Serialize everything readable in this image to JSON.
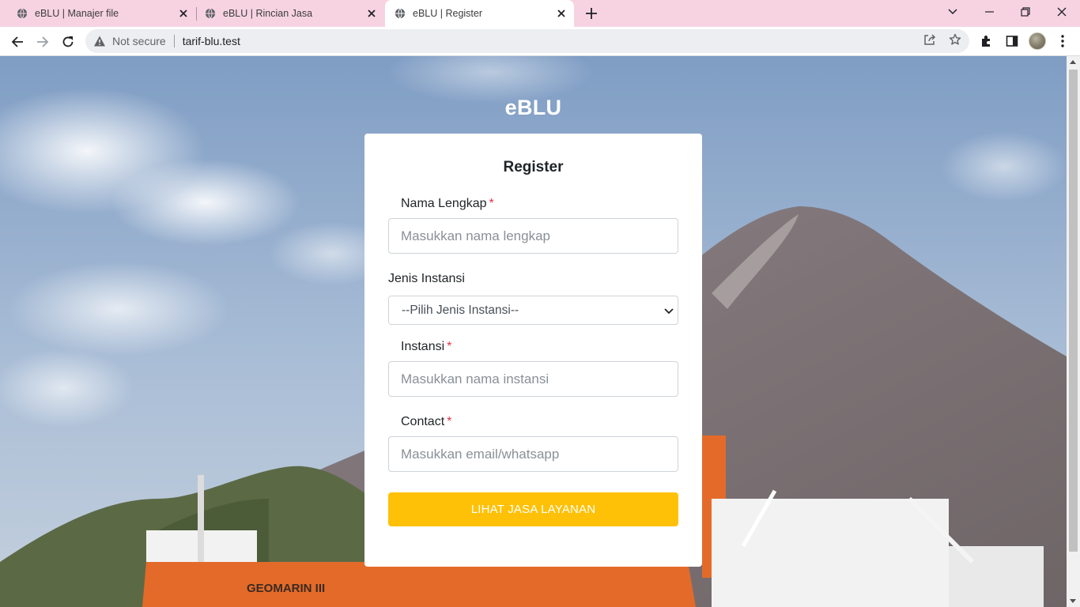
{
  "browser": {
    "tabs": [
      {
        "title": "eBLU | Manajer file",
        "active": false
      },
      {
        "title": "eBLU | Rincian Jasa",
        "active": false
      },
      {
        "title": "eBLU | Register",
        "active": true
      }
    ],
    "security_label": "Not secure",
    "url": "tarif-blu.test"
  },
  "page": {
    "brand": "eBLU",
    "ship_name": "GEOMARIN III"
  },
  "register": {
    "title": "Register",
    "fields": {
      "nama": {
        "label": "Nama Lengkap",
        "required_mark": "*",
        "placeholder": "Masukkan nama lengkap",
        "value": ""
      },
      "jenis": {
        "label": "Jenis Instansi",
        "selected": "--Pilih Jenis Instansi--"
      },
      "instansi": {
        "label": "Instansi",
        "required_mark": "*",
        "placeholder": "Masukkan nama instansi",
        "value": ""
      },
      "contact": {
        "label": "Contact",
        "required_mark": "*",
        "placeholder": "Masukkan email/whatsapp",
        "value": ""
      }
    },
    "submit_label": "LIHAT JASA LAYANAN"
  },
  "colors": {
    "tabstrip": "#f7d3e2",
    "primary_button": "#ffc107",
    "required": "#dc3545"
  },
  "icons": [
    "globe-icon",
    "close-icon",
    "plus-icon",
    "chevron-down-icon",
    "minimize-icon",
    "restore-icon",
    "back-icon",
    "forward-icon",
    "reload-icon",
    "warning-icon",
    "share-icon",
    "star-icon",
    "extensions-icon",
    "side-panel-icon",
    "menu-icon"
  ]
}
